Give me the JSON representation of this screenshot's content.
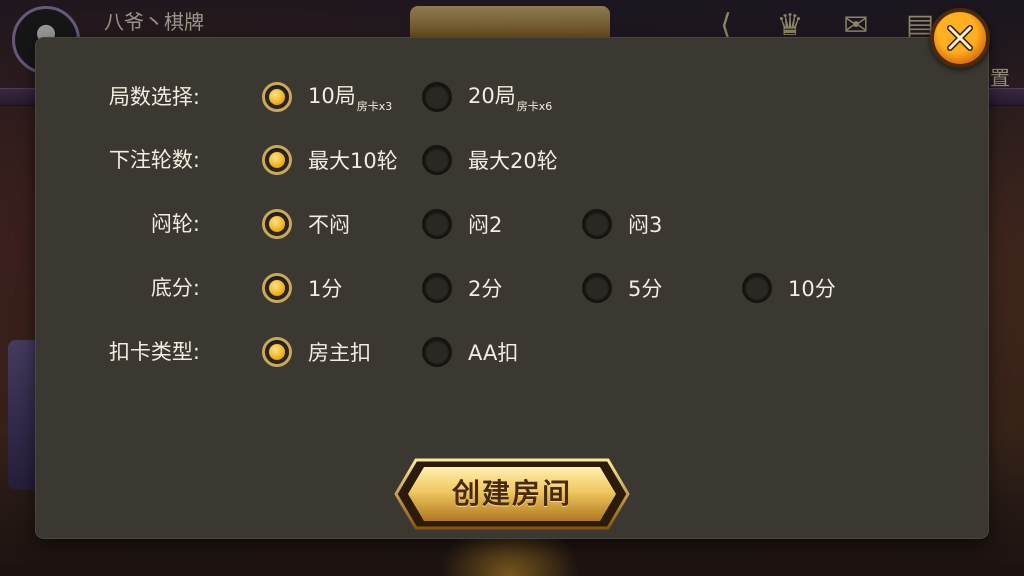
{
  "header": {
    "player_name": "八爷丶棋牌",
    "settings_label": "置"
  },
  "dialog": {
    "rows": [
      {
        "label": "局数选择:",
        "options": [
          {
            "text": "10局",
            "sub": "房卡x3",
            "selected": true
          },
          {
            "text": "20局",
            "sub": "房卡x6",
            "selected": false
          }
        ]
      },
      {
        "label": "下注轮数:",
        "options": [
          {
            "text": "最大10轮",
            "selected": true
          },
          {
            "text": "最大20轮",
            "selected": false
          }
        ]
      },
      {
        "label": "闷轮:",
        "options": [
          {
            "text": "不闷",
            "selected": true
          },
          {
            "text": "闷2",
            "selected": false
          },
          {
            "text": "闷3",
            "selected": false
          }
        ]
      },
      {
        "label": "底分:",
        "options": [
          {
            "text": "1分",
            "selected": true
          },
          {
            "text": "2分",
            "selected": false
          },
          {
            "text": "5分",
            "selected": false
          },
          {
            "text": "10分",
            "selected": false
          }
        ]
      },
      {
        "label": "扣卡类型:",
        "options": [
          {
            "text": "房主扣",
            "selected": true
          },
          {
            "text": "AA扣",
            "selected": false
          }
        ]
      }
    ],
    "create_button_label": "创建房间"
  },
  "colors": {
    "accent": "#f0b020",
    "dialog_bg": "#3a3830",
    "text": "#f2ede0"
  }
}
